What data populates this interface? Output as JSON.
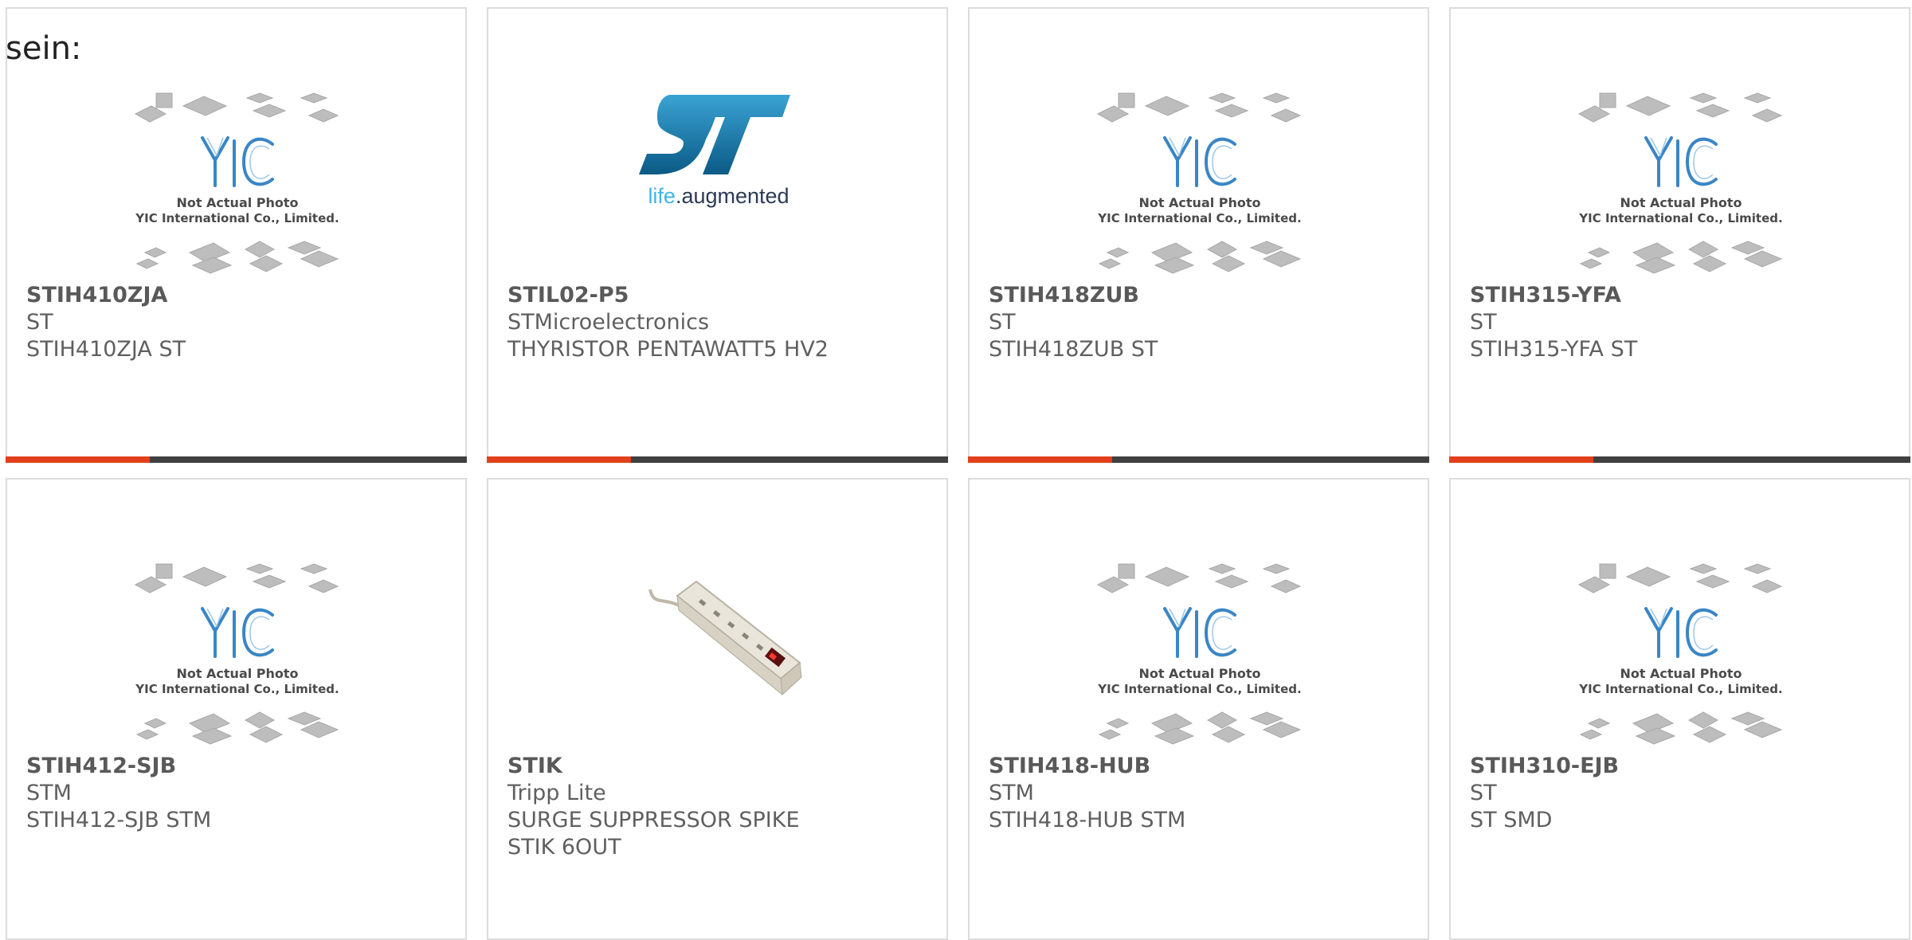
{
  "intro_text": "sein:",
  "colors": {
    "accent": "#e2401c",
    "bar_dark": "#404040",
    "border": "#dcdcdc",
    "text": "#5f5f5f",
    "yic_blue": "#3a86c6"
  },
  "placeholder": {
    "line1": "Not Actual Photo",
    "line2": "YIC International Co., Limited."
  },
  "st_logo_tag": {
    "life": "life",
    "rest": ".augmented"
  },
  "products": [
    {
      "part": "STIH410ZJA",
      "mfr": "ST",
      "desc": "STIH410ZJA ST",
      "image": "yic-placeholder"
    },
    {
      "part": "STIL02-P5",
      "mfr": "STMicroelectronics",
      "desc": "THYRISTOR PENTAWATT5 HV2",
      "image": "st-logo"
    },
    {
      "part": "STIH418ZUB",
      "mfr": "ST",
      "desc": "STIH418ZUB ST",
      "image": "yic-placeholder"
    },
    {
      "part": "STIH315-YFA",
      "mfr": "ST",
      "desc": "STIH315-YFA ST",
      "image": "yic-placeholder"
    },
    {
      "part": "STIH412-SJB",
      "mfr": "STM",
      "desc": "STIH412-SJB STM",
      "image": "yic-placeholder"
    },
    {
      "part": "STIK",
      "mfr": "Tripp Lite",
      "desc": "SURGE SUPPRESSOR SPIKE STIK 6OUT",
      "image": "power-strip-photo"
    },
    {
      "part": "STIH418-HUB",
      "mfr": "STM",
      "desc": "STIH418-HUB STM",
      "image": "yic-placeholder"
    },
    {
      "part": "STIH310-EJB",
      "mfr": "ST",
      "desc": "ST SMD",
      "image": "yic-placeholder"
    }
  ]
}
